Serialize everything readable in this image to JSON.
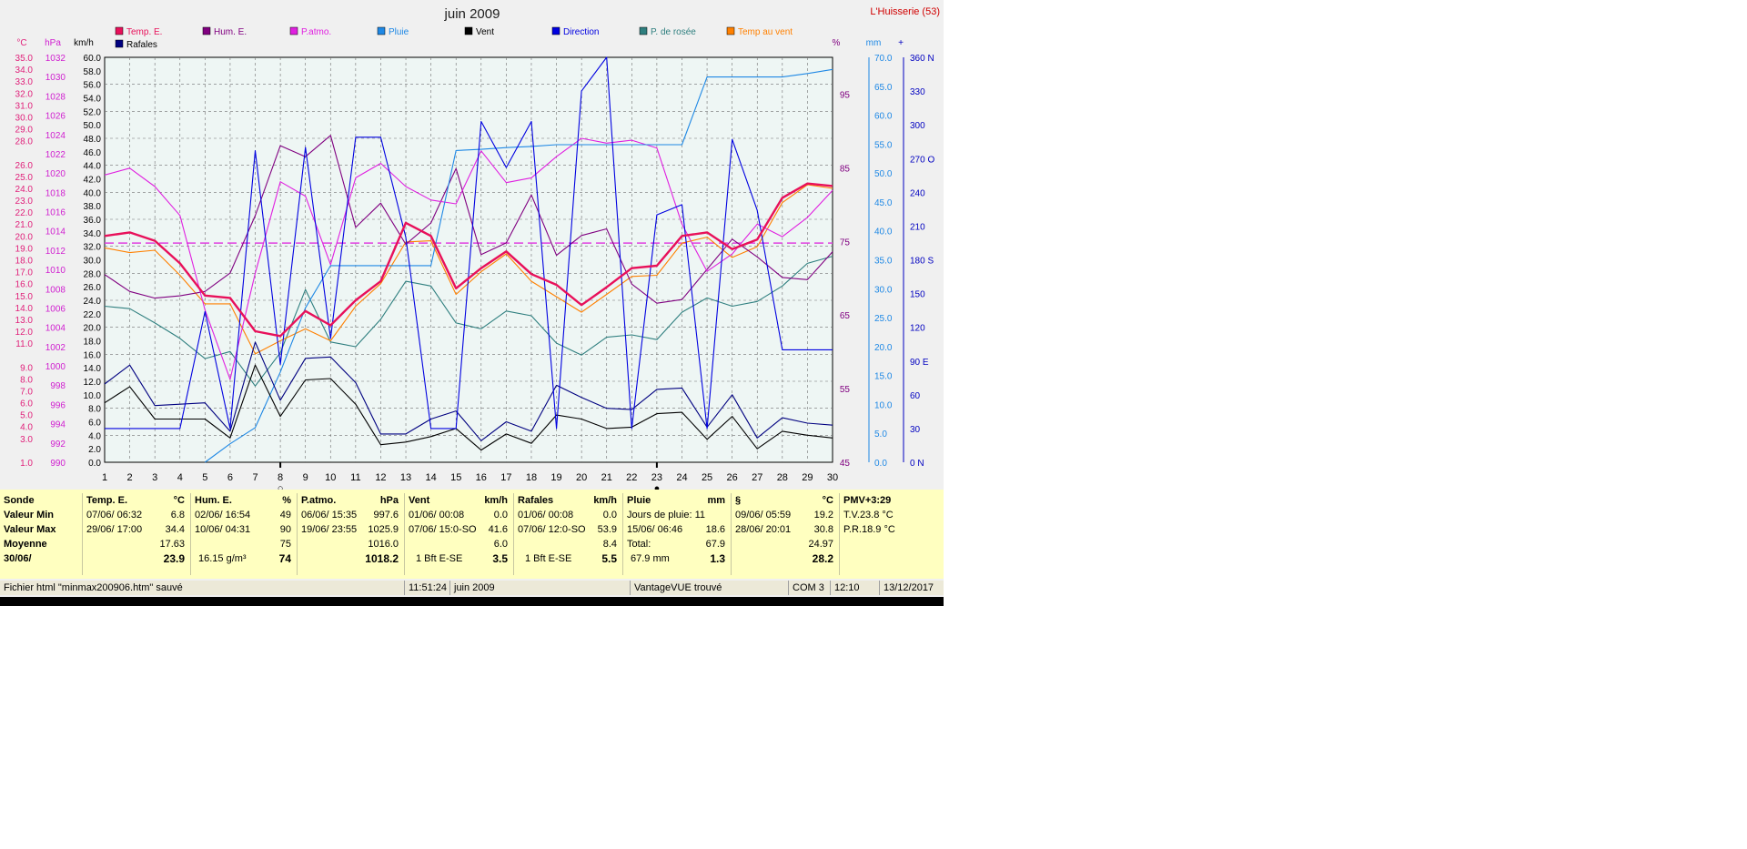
{
  "station": "L'Huisserie (53)",
  "chart_data": {
    "type": "line",
    "title": "juin 2009",
    "x": [
      1,
      2,
      3,
      4,
      5,
      6,
      7,
      8,
      9,
      10,
      11,
      12,
      13,
      14,
      15,
      16,
      17,
      18,
      19,
      20,
      21,
      22,
      23,
      24,
      25,
      26,
      27,
      28,
      29,
      30
    ],
    "xlim": [
      1,
      30
    ],
    "axes": {
      "temp": {
        "unit": "°C",
        "range": [
          1.0,
          35.0
        ],
        "color": "#e0207a",
        "ticks": [
          "35.0",
          "34.0",
          "33.0",
          "32.0",
          "31.0",
          "30.0",
          "29.0",
          "28.0",
          "26.0",
          "25.0",
          "24.0",
          "23.0",
          "22.0",
          "21.0",
          "20.0",
          "19.0",
          "18.0",
          "17.0",
          "16.0",
          "15.0",
          "14.0",
          "13.0",
          "12.0",
          "11.0",
          "9.0",
          "8.0",
          "7.0",
          "6.0",
          "5.0",
          "4.0",
          "3.0",
          "1.0"
        ]
      },
      "pressure": {
        "unit": "hPa",
        "range": [
          990,
          1032
        ],
        "color": "#d020d0",
        "ticks": [
          "1032",
          "1030",
          "1028",
          "1026",
          "1024",
          "1022",
          "1020",
          "1018",
          "1016",
          "1014",
          "1012",
          "1010",
          "1008",
          "1006",
          "1004",
          "1002",
          "1000",
          "998",
          "996",
          "994",
          "992",
          "990"
        ]
      },
      "wind": {
        "unit": "km/h",
        "range": [
          0,
          60
        ],
        "color": "#000000",
        "ticks": [
          "60.0",
          "58.0",
          "56.0",
          "54.0",
          "52.0",
          "50.0",
          "48.0",
          "46.0",
          "44.0",
          "42.0",
          "40.0",
          "38.0",
          "36.0",
          "34.0",
          "32.0",
          "30.0",
          "28.0",
          "26.0",
          "24.0",
          "22.0",
          "20.0",
          "18.0",
          "16.0",
          "14.0",
          "12.0",
          "10.0",
          "8.0",
          "6.0",
          "4.0",
          "2.0",
          "0.0"
        ]
      },
      "humidity": {
        "unit": "%",
        "range": [
          45,
          100
        ],
        "color": "#800080",
        "ticks": [
          "95",
          "85",
          "75",
          "65",
          "55",
          "45"
        ]
      },
      "rain": {
        "unit": "mm",
        "range": [
          0,
          70
        ],
        "color": "#1e88e5",
        "ticks": [
          "70.0",
          "65.0",
          "60.0",
          "55.0",
          "50.0",
          "45.0",
          "40.0",
          "35.0",
          "30.0",
          "25.0",
          "20.0",
          "15.0",
          "10.0",
          "5.0",
          "0.0"
        ]
      },
      "direction": {
        "unit": "°",
        "range": [
          0,
          360
        ],
        "color": "#0000c0",
        "ticks": [
          "360 N",
          "330",
          "300",
          "270 O",
          "240",
          "210",
          "180 S",
          "150",
          "120",
          "90  E",
          "60",
          "30",
          "0    N"
        ]
      }
    },
    "grid": true,
    "legend": [
      "top"
    ],
    "series": [
      {
        "name": "Temp. E.",
        "axis": "temp",
        "color": "#e8105a",
        "bold": true,
        "values": [
          20.0,
          20.3,
          19.6,
          17.7,
          15.0,
          14.8,
          12.0,
          11.6,
          13.7,
          12.5,
          14.6,
          16.2,
          21.1,
          20.0,
          15.6,
          17.3,
          18.7,
          16.8,
          15.9,
          14.2,
          15.7,
          17.3,
          17.5,
          20.0,
          20.3,
          18.9,
          19.7,
          23.2,
          24.4,
          24.2
        ]
      },
      {
        "name": "Hum. E.",
        "axis": "humidity",
        "color": "#800080",
        "values": [
          70.5,
          68.2,
          67.3,
          67.6,
          68.2,
          70.7,
          78.5,
          88.0,
          86.5,
          89.4,
          76.9,
          80.2,
          74.6,
          77.5,
          84.9,
          73.2,
          74.8,
          81.3,
          73.1,
          75.8,
          76.7,
          69.2,
          66.6,
          67.1,
          71.2,
          75.3,
          72.9,
          70.1,
          69.8,
          73.6
        ]
      },
      {
        "name": "P.atmo.",
        "axis": "pressure",
        "color": "#e020e0",
        "values": [
          1019.8,
          1020.5,
          1018.6,
          1015.6,
          1005.8,
          998.6,
          1009.6,
          1019.1,
          1017.6,
          1010.5,
          1019.5,
          1021.0,
          1018.6,
          1017.2,
          1016.8,
          1022.3,
          1019.0,
          1019.5,
          1021.7,
          1023.6,
          1023.1,
          1023.4,
          1022.6,
          1014.7,
          1009.8,
          1011.6,
          1014.7,
          1013.4,
          1015.4,
          1018.2
        ]
      },
      {
        "name": "Pluie",
        "axis": "rain",
        "color": "#1e88e5",
        "values": [
          null,
          null,
          null,
          null,
          0.0,
          3.2,
          6.0,
          15.6,
          26.7,
          34.0,
          34.0,
          34.0,
          34.0,
          34.0,
          53.9,
          54.1,
          54.4,
          54.6,
          54.9,
          54.9,
          54.9,
          54.9,
          54.9,
          54.9,
          66.6,
          66.6,
          66.6,
          66.6,
          67.2,
          67.9
        ]
      },
      {
        "name": "Vent",
        "axis": "wind",
        "color": "#000000",
        "values": [
          8.8,
          11.2,
          6.4,
          6.4,
          6.4,
          3.6,
          14.4,
          6.8,
          12.2,
          12.4,
          8.6,
          2.6,
          3.0,
          3.8,
          5.0,
          1.8,
          4.2,
          2.8,
          7.0,
          6.4,
          5.0,
          5.2,
          7.2,
          7.4,
          3.4,
          6.8,
          2.0,
          4.6,
          4.0,
          3.6
        ]
      },
      {
        "name": "Rafales",
        "axis": "wind",
        "color": "#000080",
        "values": [
          11.6,
          14.4,
          8.4,
          8.6,
          8.8,
          4.6,
          17.8,
          9.2,
          15.4,
          15.6,
          11.8,
          4.2,
          4.2,
          6.4,
          7.6,
          3.2,
          6.0,
          4.6,
          11.4,
          9.6,
          8.0,
          7.8,
          10.8,
          11.0,
          5.2,
          10.0,
          3.6,
          6.6,
          5.8,
          5.5
        ]
      },
      {
        "name": "Direction",
        "axis": "direction",
        "color": "#0000e0",
        "values": [
          30,
          30,
          30,
          30,
          134,
          30,
          277,
          87,
          280,
          110,
          289,
          289,
          200,
          30,
          30,
          303,
          262,
          303,
          30,
          330,
          360,
          30,
          220,
          229,
          30,
          287,
          224,
          100,
          100,
          100
        ]
      },
      {
        "name": "P. de rosée",
        "axis": "temp",
        "color": "#2f7f7f",
        "values": [
          14.1,
          13.9,
          12.7,
          11.4,
          9.7,
          10.3,
          7.4,
          10.2,
          15.5,
          11.1,
          10.7,
          13.0,
          16.2,
          15.8,
          12.7,
          12.2,
          13.7,
          13.3,
          11.0,
          10.0,
          11.5,
          11.7,
          11.3,
          13.6,
          14.8,
          14.1,
          14.5,
          15.8,
          17.7,
          18.3
        ]
      },
      {
        "name": "Temp au vent",
        "axis": "temp",
        "color": "#ff8000",
        "values": [
          19.0,
          18.6,
          18.8,
          16.7,
          14.3,
          14.3,
          10.1,
          11.2,
          12.2,
          11.2,
          14.1,
          16.0,
          19.5,
          19.6,
          15.1,
          17.0,
          18.5,
          16.2,
          14.9,
          13.6,
          15.1,
          16.6,
          16.7,
          19.4,
          19.9,
          18.2,
          19.1,
          22.8,
          24.3,
          24.0
        ]
      }
    ],
    "reference_line": {
      "axis": "temp",
      "value": 19.4,
      "color": "#e040e0"
    },
    "moon_markers": [
      {
        "x": 8,
        "symbol": "○"
      },
      {
        "x": 23,
        "symbol": "●"
      }
    ]
  },
  "summary": {
    "row_labels": [
      "Sonde",
      "Valeur Min",
      "Valeur Max",
      "Moyenne",
      "30/06/"
    ],
    "temp": {
      "title": "Temp. E.",
      "unit": "°C",
      "min_when": "07/06/  06:32",
      "min": "6.8",
      "max_when": "29/06/  17:00",
      "max": "34.4",
      "avg": "17.63",
      "cur_left": "",
      "cur": "23.9"
    },
    "hum": {
      "title": "Hum. E.",
      "unit": "%",
      "min_when": "02/06/  16:54",
      "min": "49",
      "max_when": "10/06/  04:31",
      "max": "90",
      "avg": "75",
      "cur_left": "16.15 g/m³",
      "cur": "74"
    },
    "patmo": {
      "title": "P.atmo.",
      "unit": "hPa",
      "min_when": "06/06/  15:35",
      "min": "997.6",
      "max_when": "19/06/  23:55",
      "max": "1025.9",
      "avg": "1016.0",
      "cur_left": "",
      "cur": "1018.2"
    },
    "vent": {
      "title": "Vent",
      "unit": "km/h",
      "min_when": "01/06/  00:08",
      "min": "0.0",
      "max_when": "07/06/  15:0-SO",
      "max": "41.6",
      "avg": "6.0",
      "cur_left": "1 Bft E-SE",
      "cur": "3.5"
    },
    "rafales": {
      "title": "Rafales",
      "unit": "km/h",
      "min_when": "01/06/  00:08",
      "min": "0.0",
      "max_when": "07/06/  12:0-SO",
      "max": "53.9",
      "avg": "8.4",
      "cur_left": "1 Bft E-SE",
      "cur": "5.5"
    },
    "pluie": {
      "title": "Pluie",
      "unit": "mm",
      "min_when": "Jours de pluie: 11",
      "min": "",
      "max_when": "15/06/  06:46",
      "max": "18.6",
      "avg_left": "Total:",
      "avg": "67.9",
      "cur_left": "67.9 mm",
      "cur": "1.3"
    },
    "section": {
      "title": "§",
      "unit": "°C",
      "min_when": "09/06/  05:59",
      "min": "19.2",
      "max_when": "28/06/  20:01",
      "max": "30.8",
      "avg": "24.97",
      "cur": "28.2"
    },
    "pmv": {
      "title": "PMV+3:29",
      "line1": "T.V.23.8 °C",
      "line2": "P.R.18.9 °C"
    }
  },
  "status": {
    "file": "Fichier html  \"minmax200906.htm\"  sauvé",
    "time": "11:51:24",
    "month": "juin 2009",
    "device": "VantageVUE trouvé",
    "port": "COM 3",
    "clock": "12:10",
    "date": "13/12/2017"
  }
}
